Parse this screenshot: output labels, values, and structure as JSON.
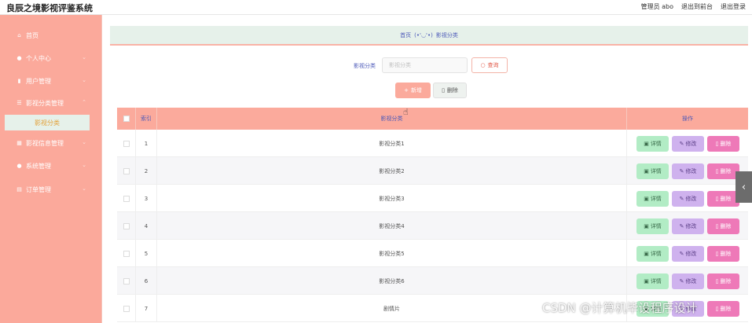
{
  "header": {
    "title": "良辰之境影视评鉴系统",
    "admin_label": "管理员 abo",
    "front_link": "退出到前台",
    "logout_link": "退出登录"
  },
  "sidebar": {
    "items": [
      {
        "icon": "home-icon",
        "label": "首页"
      },
      {
        "icon": "user-icon",
        "label": "个人中心"
      },
      {
        "icon": "bar-chart-icon",
        "label": "用户管理"
      },
      {
        "icon": "list-icon",
        "label": "影视分类管理"
      },
      {
        "icon": "grid-icon",
        "label": "影视信息管理"
      },
      {
        "icon": "location-icon",
        "label": "系统管理"
      },
      {
        "icon": "table-icon",
        "label": "订单管理"
      }
    ],
    "active_sub": "影视分类"
  },
  "breadcrumb": {
    "home": "首页",
    "emoji": "(•'◡'•)",
    "current": "影视分类"
  },
  "search": {
    "label": "影视分类",
    "placeholder": "影视分类",
    "query_button": "查询"
  },
  "actions": {
    "add_button": "新增",
    "delete_button": "删除"
  },
  "table": {
    "headers": {
      "index": "索引",
      "category": "影视分类",
      "ops": "操作"
    },
    "op_labels": {
      "detail": "详情",
      "edit": "修改",
      "delete": "删除"
    },
    "rows": [
      {
        "index": "1",
        "category": "影视分类1"
      },
      {
        "index": "2",
        "category": "影视分类2"
      },
      {
        "index": "3",
        "category": "影视分类3"
      },
      {
        "index": "4",
        "category": "影视分类4"
      },
      {
        "index": "5",
        "category": "影视分类5"
      },
      {
        "index": "6",
        "category": "影视分类6"
      },
      {
        "index": "7",
        "category": "剧情片"
      }
    ]
  },
  "watermark": "CSDN @计算机毕设程序设计",
  "colors": {
    "sidebar_bg": "#fba99b",
    "header_bg": "#fbaa9c",
    "breadcrumb_bg": "#e6f1ea",
    "detail_btn": "#b2ecc5",
    "edit_btn": "#cfb2ee",
    "delete_btn": "#ee79b8"
  }
}
